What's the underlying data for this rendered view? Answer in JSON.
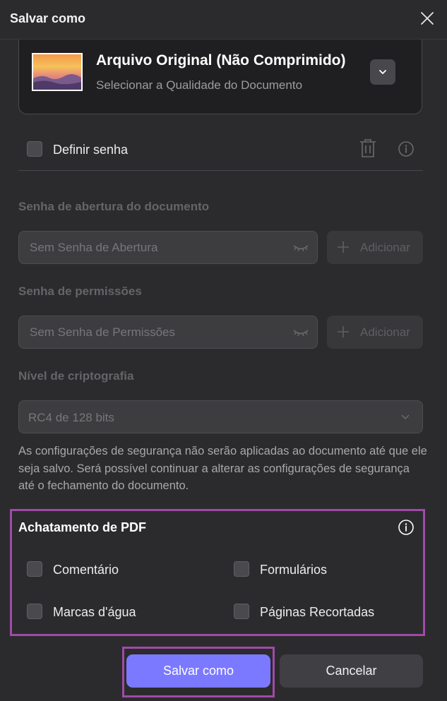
{
  "dialog": {
    "title": "Salvar como"
  },
  "quality": {
    "title": "Arquivo Original (Não Comprimido)",
    "subtitle": "Selecionar a Qualidade do Documento"
  },
  "password": {
    "checkbox_label": "Definir senha",
    "checked": false,
    "open_section_label": "Senha de abertura do documento",
    "open_placeholder": "Sem Senha de Abertura",
    "open_add_label": "Adicionar",
    "perm_section_label": "Senha de permissões",
    "perm_placeholder": "Sem Senha de Permissões",
    "perm_add_label": "Adicionar",
    "encryption_label": "Nível de criptografia",
    "encryption_value": "RC4 de 128 bits",
    "info_text": "As configurações de segurança não serão aplicadas ao documento até que ele seja salvo. Será possível continuar a alterar as configurações de segurança até o fechamento do documento."
  },
  "flatten": {
    "title": "Achatamento de PDF",
    "options": [
      {
        "label": "Comentário",
        "checked": false
      },
      {
        "label": "Formulários",
        "checked": false
      },
      {
        "label": "Marcas d'água",
        "checked": false
      },
      {
        "label": "Páginas Recortadas",
        "checked": false
      }
    ]
  },
  "footer": {
    "save_label": "Salvar como",
    "cancel_label": "Cancelar"
  },
  "colors": {
    "background": "#2b2b2d",
    "accent": "#7b79ff",
    "highlight_border": "#a04aa8"
  },
  "icons": {
    "close": "close-icon",
    "quality_dropdown": "chevron-down-icon",
    "delete": "trash-icon",
    "info": "info-icon",
    "eye_hidden": "eye-closed-icon",
    "add": "plus-icon"
  }
}
